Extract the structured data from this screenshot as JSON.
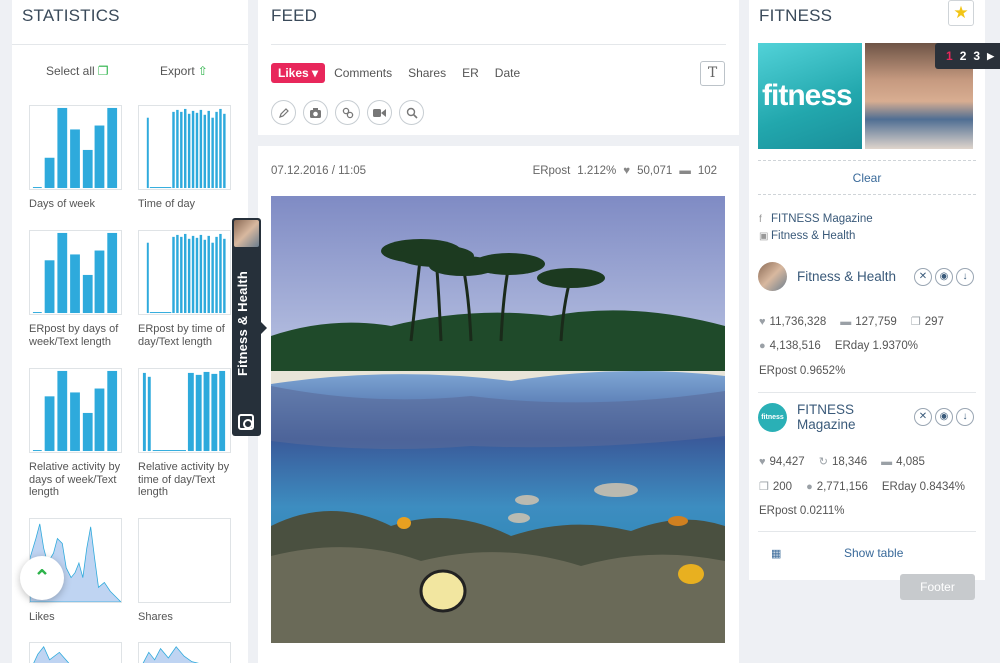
{
  "statistics": {
    "title": "STATISTICS",
    "select_all": "Select all",
    "export": "Export",
    "thumbs": [
      {
        "label": "Days of week"
      },
      {
        "label": "Time of day"
      },
      {
        "label": "ERpost by days of week/Text length"
      },
      {
        "label": "ERpost by time of day/Text length"
      },
      {
        "label": "Relative activity by days of week/Text length"
      },
      {
        "label": "Relative activity by time of day/Text length"
      },
      {
        "label": "Likes"
      },
      {
        "label": "Shares"
      }
    ]
  },
  "feed": {
    "title": "FEED",
    "sort_tabs": [
      "Likes",
      "Comments",
      "Shares",
      "ER",
      "Date"
    ],
    "text_toggle": "T",
    "tool_icons": [
      "pencil-icon",
      "camera-icon",
      "link-icon",
      "video-icon",
      "search-icon"
    ],
    "post": {
      "date": "07.12.2016 / 11:05",
      "erpost_label": "ERpost",
      "erpost_value": "1.212%",
      "likes": "50,071",
      "comments": "102"
    }
  },
  "sidetab": {
    "label": "Fitness & Health"
  },
  "fitness": {
    "title": "FITNESS",
    "image_text": "fitness",
    "pages": [
      "1",
      "2",
      "3"
    ],
    "current_page": "1",
    "clear": "Clear",
    "sources": [
      {
        "icon": "facebook-icon",
        "text": "FITNESS Magazine"
      },
      {
        "icon": "instagram-icon",
        "text": "Fitness & Health"
      }
    ],
    "accounts": [
      {
        "name": "Fitness & Health",
        "likes": "11,736,328",
        "comments": "127,759",
        "posts": "297",
        "followers": "4,138,516",
        "erday": "ERday 1.9370%",
        "erpost": "ERpost 0.9652%"
      },
      {
        "name": "FITNESS Magazine",
        "avatar_text": "fitness",
        "likes": "94,427",
        "reposts": "18,346",
        "comments": "4,085",
        "posts": "200",
        "followers": "2,771,156",
        "erday": "ERday 0.8434%",
        "erpost": "ERpost 0.0211%"
      }
    ],
    "show_table": "Show table"
  },
  "footer": "Footer",
  "colors": {
    "accent": "#e8275b",
    "chart": "#2eaadc",
    "green": "#2db34a"
  }
}
